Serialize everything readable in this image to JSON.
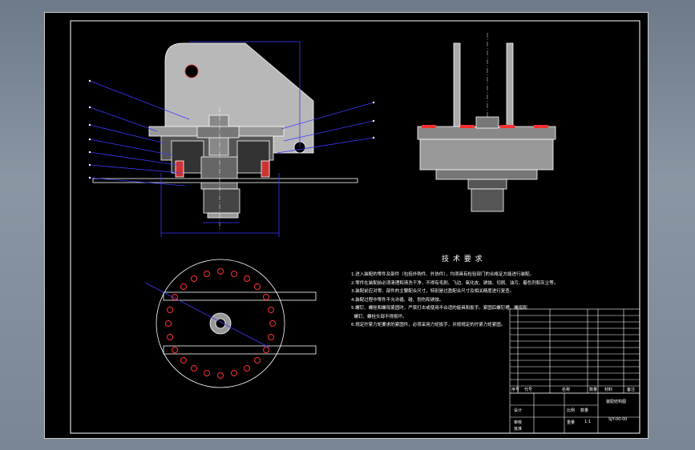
{
  "drawing": {
    "title": "装配结构图",
    "code": "SJY-00-00",
    "labels": {
      "designer": "设计",
      "check": "审核",
      "approve": "批准",
      "scale": "比例",
      "qty": "数量",
      "weight": "重量",
      "sheet_ratio": "1:1"
    }
  },
  "technical_requirements": {
    "title": "技 术 要 求",
    "lines": [
      "1.进入装配的零件及部件（包括外购件、外协件），均须具有检验部门的合格证方能进行装配。",
      "2.零件在装配前必须清理和清洗干净，不得有毛刺、飞边、氧化皮、锈蚀、切屑、油污、着色剂和灰尘等。",
      "3.装配前应对零、部件的主要配合尺寸，特别是过盈配合尺寸及相关精度进行复查。",
      "4.装配过程中零件不允许磕、碰、划伤和锈蚀。",
      "5.螺钉、螺栓和螺母紧固时，严禁打击或使用不合适的旋具和扳手。紧固后螺钉槽、螺母和",
      "  螺钉、螺栓头部不得损坏。",
      "6.规定拧紧力矩要求的紧固件，必须采用力矩扳手，并按规定的拧紧力矩紧固。"
    ]
  },
  "bom": {
    "header": [
      "序号",
      "代号",
      "名称",
      "数量",
      "材料",
      "备注"
    ]
  },
  "colors": {
    "sheet": "#000000",
    "outline": "#ffffff",
    "leader": "#3a3aff",
    "bolt": "#ff3030",
    "part": "#d0d0d0"
  }
}
